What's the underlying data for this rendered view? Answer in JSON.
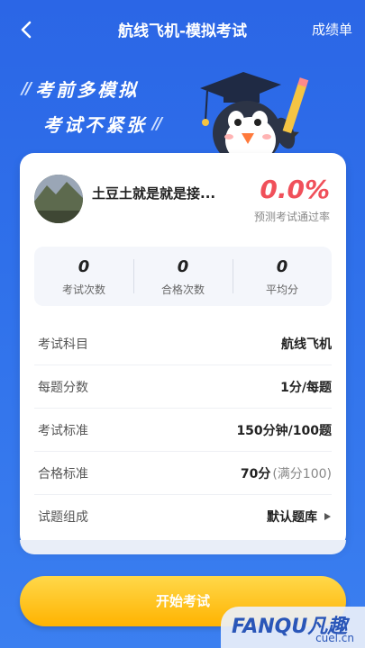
{
  "header": {
    "title": "航线飞机-模拟考试",
    "report_label": "成绩单"
  },
  "slogan": {
    "line1": "考前多模拟",
    "line2": "考试不紧张"
  },
  "profile": {
    "username": "土豆土就是就是接...",
    "pass_rate": "0.0%",
    "pass_rate_label": "预测考试通过率"
  },
  "stats": [
    {
      "value": "0",
      "label": "考试次数"
    },
    {
      "value": "0",
      "label": "合格次数"
    },
    {
      "value": "0",
      "label": "平均分"
    }
  ],
  "details": [
    {
      "label": "考试科目",
      "value": "航线飞机",
      "sub": ""
    },
    {
      "label": "每题分数",
      "value": "1分/每题",
      "sub": ""
    },
    {
      "label": "考试标准",
      "value": "150分钟/100题",
      "sub": ""
    },
    {
      "label": "合格标准",
      "value": "70分",
      "sub": "(满分100)"
    },
    {
      "label": "试题组成",
      "value": "默认题库",
      "sub": ""
    }
  ],
  "start_button": "开始考试",
  "watermark": {
    "main": "FANQU凡趣",
    "sub": "cuel.cn"
  },
  "colors": {
    "background": "#2f6fe8",
    "pass_rate": "#f0505a",
    "button": "#ffb300"
  }
}
